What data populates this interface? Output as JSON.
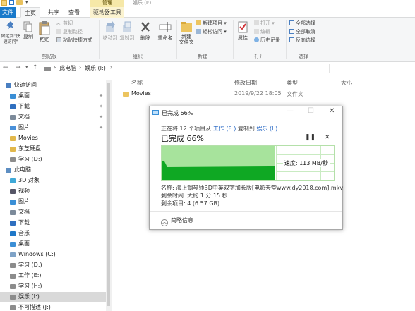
{
  "window": {
    "contextual_tab": "管理",
    "title": "娱乐 (I:)"
  },
  "ribbon_tabs": [
    "文件",
    "主页",
    "共享",
    "查看",
    "驱动器工具"
  ],
  "ribbon": {
    "pin_label": "固定到\"快速访问\"",
    "copy_label": "复制",
    "paste_label": "粘贴",
    "cut_label": "剪切",
    "copy_path_label": "复制路径",
    "paste_shortcut_label": "粘贴快捷方式",
    "clipboard_group": "剪贴板",
    "move_to_label": "移动到",
    "copy_to_label": "复制到",
    "delete_label": "删除",
    "rename_label": "重命名",
    "organize_group": "组织",
    "new_folder_label": "新建\n文件夹",
    "new_item_label": "新建项目 ▾",
    "easy_access_label": "轻松访问 ▾",
    "new_group": "新建",
    "properties_label": "属性",
    "open_label": "打开 ▾",
    "edit_label": "编辑",
    "history_label": "历史记录",
    "open_group": "打开",
    "select_all_label": "全部选择",
    "select_none_label": "全部取消",
    "invert_label": "反向选择",
    "select_group": "选择"
  },
  "address": {
    "back": "←",
    "forward": "→",
    "up": "↑",
    "parts": [
      "此电脑",
      "娱乐 (I:)"
    ],
    "sep": "›"
  },
  "nav": {
    "items": [
      {
        "label": "快速访问",
        "pinned": false
      },
      {
        "label": "桌面",
        "pinned": true
      },
      {
        "label": "下载",
        "pinned": true
      },
      {
        "label": "文档",
        "pinned": true
      },
      {
        "label": "图片",
        "pinned": true
      },
      {
        "label": "Movies",
        "pinned": false
      },
      {
        "label": "东芝硬盘",
        "pinned": false
      },
      {
        "label": "学习 (D:)",
        "pinned": false
      },
      {
        "label": "此电脑",
        "pinned": false
      },
      {
        "label": "3D 对象",
        "pinned": false
      },
      {
        "label": "视频",
        "pinned": false
      },
      {
        "label": "图片",
        "pinned": false
      },
      {
        "label": "文档",
        "pinned": false
      },
      {
        "label": "下载",
        "pinned": false
      },
      {
        "label": "音乐",
        "pinned": false
      },
      {
        "label": "桌面",
        "pinned": false
      },
      {
        "label": "Windows (C:)",
        "pinned": false
      },
      {
        "label": "学习 (D:)",
        "pinned": false
      },
      {
        "label": "工作 (E:)",
        "pinned": false
      },
      {
        "label": "学习 (H:)",
        "pinned": false
      },
      {
        "label": "娱乐 (I:)",
        "pinned": false,
        "selected": true
      },
      {
        "label": "不可描述 (J:)",
        "pinned": false
      }
    ],
    "pin_glyph": "✦"
  },
  "columns": {
    "name": "名称",
    "date": "修改日期",
    "type": "类型",
    "size": "大小"
  },
  "files": [
    {
      "name": "Movies",
      "date": "2019/9/22 18:05",
      "type": "文件夹",
      "size": ""
    }
  ],
  "dialog": {
    "title": "已完成 66%",
    "minimize": "—",
    "maximize": "☐",
    "close": "✕",
    "line_prefix": "正在将 12 个项目从 ",
    "source": "工作 (E:)",
    "line_mid": " 复制到 ",
    "dest": "娱乐 (I:)",
    "progress_text": "已完成 66%",
    "pause": "❚❚",
    "cancel": "✕",
    "progress": 0.66,
    "speed": "速度: 113 MB/秒",
    "name_line": "名称: 海上钢琴师BD中英双字加长版[电影天堂www.dy2018.com].mkv",
    "time_line": "剩余时间: 大约 1 分 15 秒",
    "items_line": "剩余项目: 4 (6.57 GB)",
    "less_info": "简略信息",
    "less_glyph": "︿"
  }
}
